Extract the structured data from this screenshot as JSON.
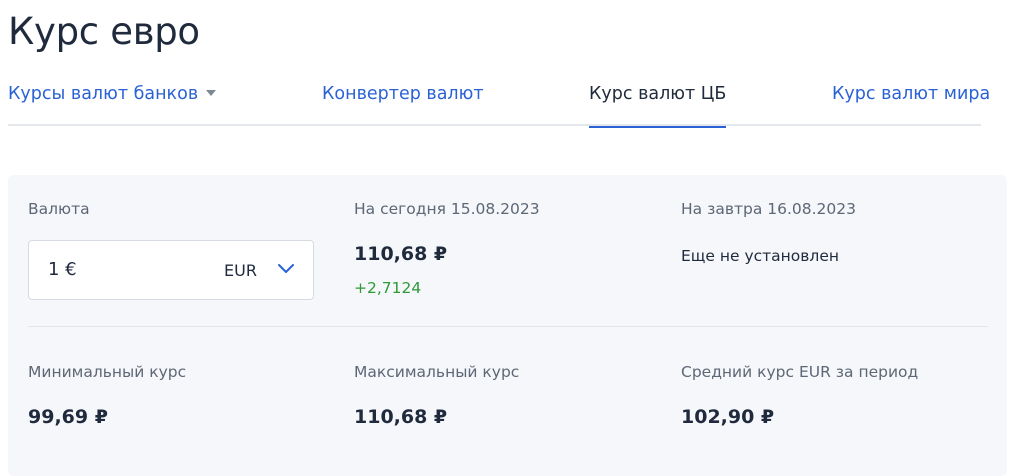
{
  "page": {
    "title": "Курс евро"
  },
  "tabs": [
    {
      "label": "Курсы валют банков",
      "has_dropdown": true,
      "active": false
    },
    {
      "label": "Конвертер валют",
      "active": false
    },
    {
      "label": "Курс валют ЦБ",
      "active": true
    },
    {
      "label": "Курс валют мира",
      "active": false
    }
  ],
  "rates": {
    "currency_label": "Валюта",
    "currency_amount": "1 €",
    "currency_code": "EUR",
    "today_label": "На сегодня 15.08.2023",
    "today_value": "110,68 ₽",
    "today_change": "+2,7124",
    "tomorrow_label": "На завтра 16.08.2023",
    "tomorrow_status": "Еще не установлен",
    "min_label": "Минимальный курс",
    "min_value": "99,69 ₽",
    "max_label": "Максимальный курс",
    "max_value": "110,68 ₽",
    "avg_label": "Средний курс EUR за период",
    "avg_value": "102,90 ₽"
  },
  "colors": {
    "link": "#2a62d6",
    "text": "#1f2a3d",
    "positive": "#2f9a38",
    "card_bg": "#f5f7fa"
  },
  "icons": {
    "tab_dropdown": "caret-down-icon",
    "currency_dropdown": "chevron-down-icon"
  }
}
